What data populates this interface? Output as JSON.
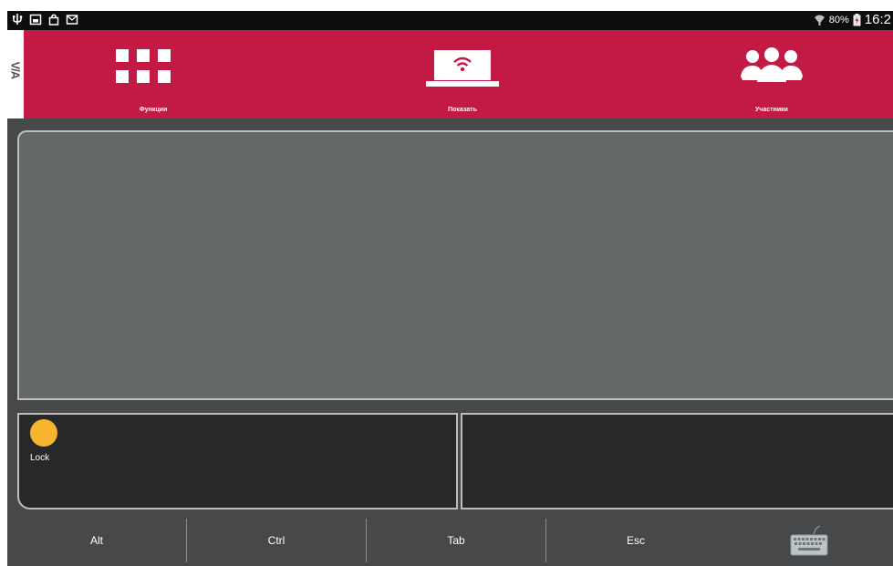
{
  "status_bar": {
    "left_icons": [
      "usb-icon",
      "image-icon",
      "bag-icon",
      "mail-icon"
    ],
    "battery": "80%",
    "time": "16:2",
    "right_icons": [
      "wifi-icon",
      "battery-icon"
    ]
  },
  "logo": {
    "text": "V/A"
  },
  "nav": {
    "items": [
      {
        "label": "Функции",
        "icon": "grid-icon"
      },
      {
        "label": "Показать",
        "icon": "laptop-wifi-icon"
      },
      {
        "label": "Участники",
        "icon": "participants-icon"
      }
    ]
  },
  "touchpad": {
    "lock_label": "Lock"
  },
  "keys": {
    "items": [
      {
        "label": "Alt"
      },
      {
        "label": "Ctrl"
      },
      {
        "label": "Tab"
      },
      {
        "label": "Esc"
      }
    ],
    "keyboard_icon": "keyboard-icon"
  },
  "colors": {
    "accent": "#c21a45",
    "lock": "#f7b52d",
    "pad": "#656869",
    "button": "#262829",
    "background": "#464849"
  }
}
